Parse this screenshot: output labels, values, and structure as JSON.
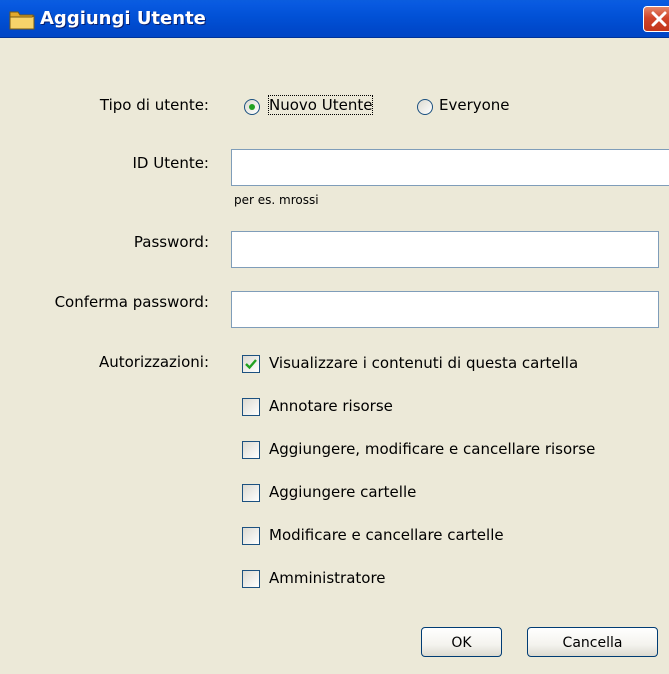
{
  "window": {
    "title": "Aggiungi Utente"
  },
  "user_type": {
    "label": "Tipo di utente:",
    "options": [
      {
        "label": "Nuovo Utente",
        "selected": true
      },
      {
        "label": "Everyone",
        "selected": false
      }
    ]
  },
  "user_id": {
    "label": "ID Utente:",
    "value": "",
    "hint": "per es. mrossi"
  },
  "password": {
    "label": "Password:",
    "value": ""
  },
  "confirm_password": {
    "label": "Conferma password:",
    "value": ""
  },
  "permissions": {
    "label": "Autorizzazioni:",
    "items": [
      {
        "label": "Visualizzare i contenuti di questa cartella",
        "checked": true
      },
      {
        "label": "Annotare risorse",
        "checked": false
      },
      {
        "label": "Aggiungere, modificare e cancellare risorse",
        "checked": false
      },
      {
        "label": "Aggiungere cartelle",
        "checked": false
      },
      {
        "label": "Modificare e cancellare cartelle",
        "checked": false
      },
      {
        "label": "Amministratore",
        "checked": false
      }
    ]
  },
  "buttons": {
    "ok": "OK",
    "cancel": "Cancella"
  },
  "colors": {
    "titlebar": "#0451d8",
    "dialog_bg": "#ece9d8",
    "check_mark": "#21a121"
  },
  "icons": {
    "title": "folder-icon",
    "close": "close-icon"
  }
}
